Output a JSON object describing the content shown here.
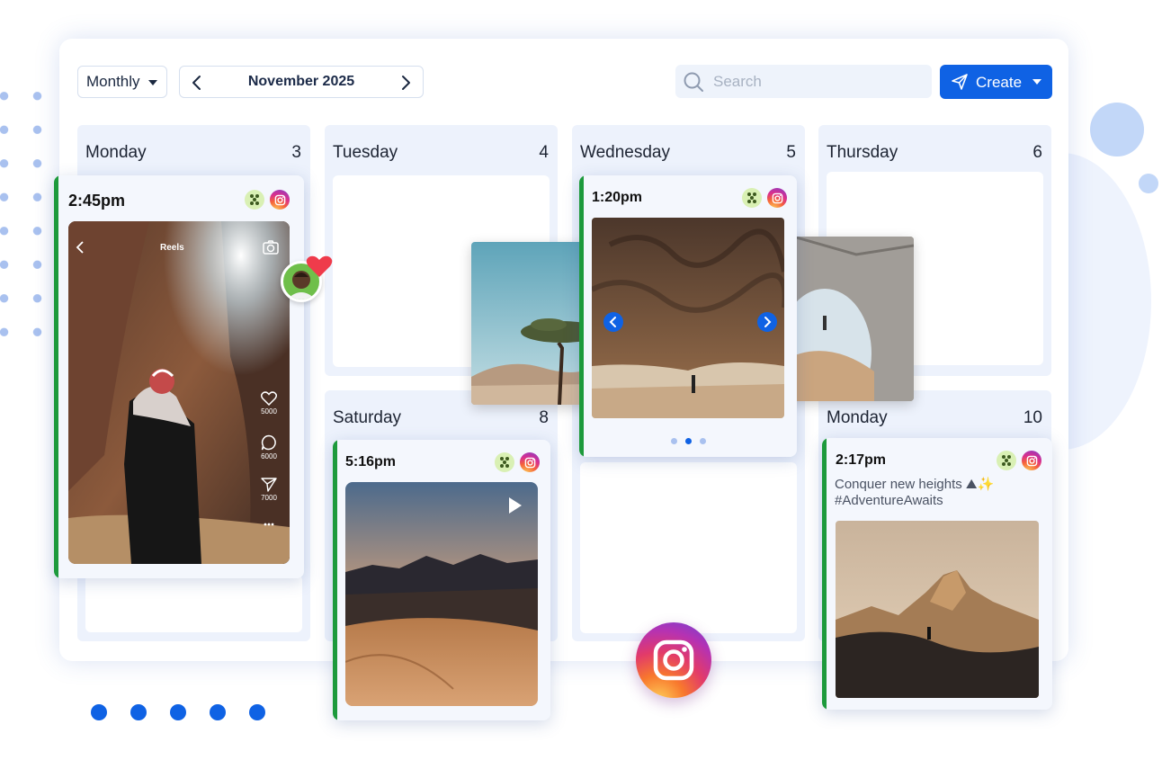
{
  "toolbar": {
    "view_mode": "Monthly",
    "month_label": "November 2025",
    "search_placeholder": "Search",
    "create_label": "Create"
  },
  "days": [
    {
      "name": "Monday",
      "number": "3"
    },
    {
      "name": "Tuesday",
      "number": "4"
    },
    {
      "name": "Wednesday",
      "number": "5"
    },
    {
      "name": "Thursday",
      "number": "6"
    },
    {
      "name": "Saturday",
      "number": "8"
    },
    {
      "name": "Monday",
      "number": "10"
    }
  ],
  "posts": {
    "reel": {
      "time": "2:45pm",
      "header": "Reels",
      "likes": "5000",
      "comments": "6000",
      "shares": "7000"
    },
    "carousel": {
      "time": "1:20pm"
    },
    "video": {
      "time": "5:16pm"
    },
    "caption_post": {
      "time": "2:17pm",
      "caption_line1": "Conquer new heights ⛰✨",
      "caption_line2": "#AdventureAwaits"
    }
  },
  "colors": {
    "accent": "#0f62e4",
    "scheduled_bar": "#1d9a3c",
    "cell_bg": "#edf2fc"
  },
  "icons": [
    "chevron-left-icon",
    "chevron-right-icon",
    "search-icon",
    "send-icon",
    "instagram-icon",
    "hive-icon",
    "heart-icon",
    "play-icon",
    "camera-icon",
    "comment-icon",
    "more-icon"
  ]
}
